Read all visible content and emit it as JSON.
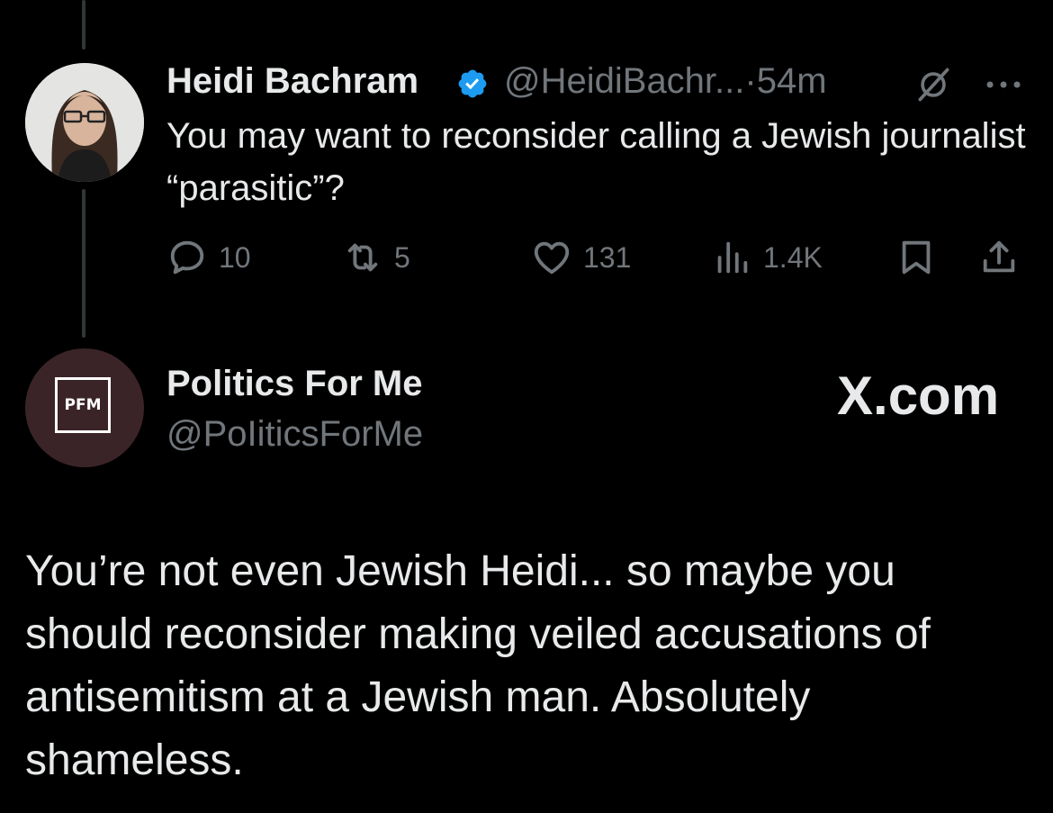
{
  "tweet1": {
    "author_name": "Heidi Bachram",
    "handle": "@HeidiBachr...",
    "separator": "·",
    "time": "54m",
    "text": "You may want to reconsider calling a Jewish journalist “parasitic”?",
    "actions": {
      "replies": "10",
      "reposts": "5",
      "likes": "131",
      "views": "1.4K"
    }
  },
  "tweet2": {
    "author_name": "Politics For Me",
    "handle": "@PoIiticsForMe",
    "avatar_text": "PFM",
    "watermark": "X.com",
    "text": "You’re not even Jewish Heidi... so maybe you should reconsider making veiled accusations of antisemitism at a Jewish man. Absolutely shameless."
  },
  "icons": [
    "verified-badge-icon",
    "grok-icon",
    "more-icon",
    "reply-icon",
    "repost-icon",
    "like-icon",
    "views-icon",
    "bookmark-icon",
    "share-icon"
  ],
  "colors": {
    "background": "#000000",
    "text": "#e7e9ea",
    "secondary": "#71767b",
    "verified": "#1d9bf0",
    "pfm_avatar": "#3b2428"
  }
}
